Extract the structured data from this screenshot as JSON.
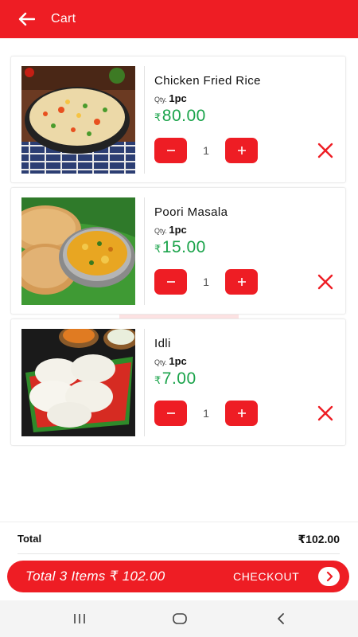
{
  "app_bar": {
    "title": "Cart"
  },
  "items": [
    {
      "name": "Chicken Fried Rice",
      "qty_prefix": "Qty.",
      "qty_value": "1pc",
      "currency": "₹",
      "price": "80.00",
      "count": "1"
    },
    {
      "name": "Poori Masala",
      "qty_prefix": "Qty.",
      "qty_value": "1pc",
      "currency": "₹",
      "price": "15.00",
      "count": "1"
    },
    {
      "name": "Idli",
      "qty_prefix": "Qty.",
      "qty_value": "1pc",
      "currency": "₹",
      "price": "7.00",
      "count": "1"
    }
  ],
  "total": {
    "label": "Total",
    "value": "₹102.00"
  },
  "checkout": {
    "summary": "Total 3 Items ₹ 102.00",
    "label": "CHECKOUT"
  },
  "icons": {
    "back": "arrow-left-icon",
    "minus": "minus-icon",
    "plus": "plus-icon",
    "remove": "close-icon",
    "checkout_arrow": "chevron-right-icon",
    "nav_recents": "recents-icon",
    "nav_home": "home-icon",
    "nav_back": "back-chevron-icon"
  },
  "colors": {
    "primary": "#ee1d24",
    "price_green": "#1aa34a",
    "text_dark": "#111111"
  }
}
